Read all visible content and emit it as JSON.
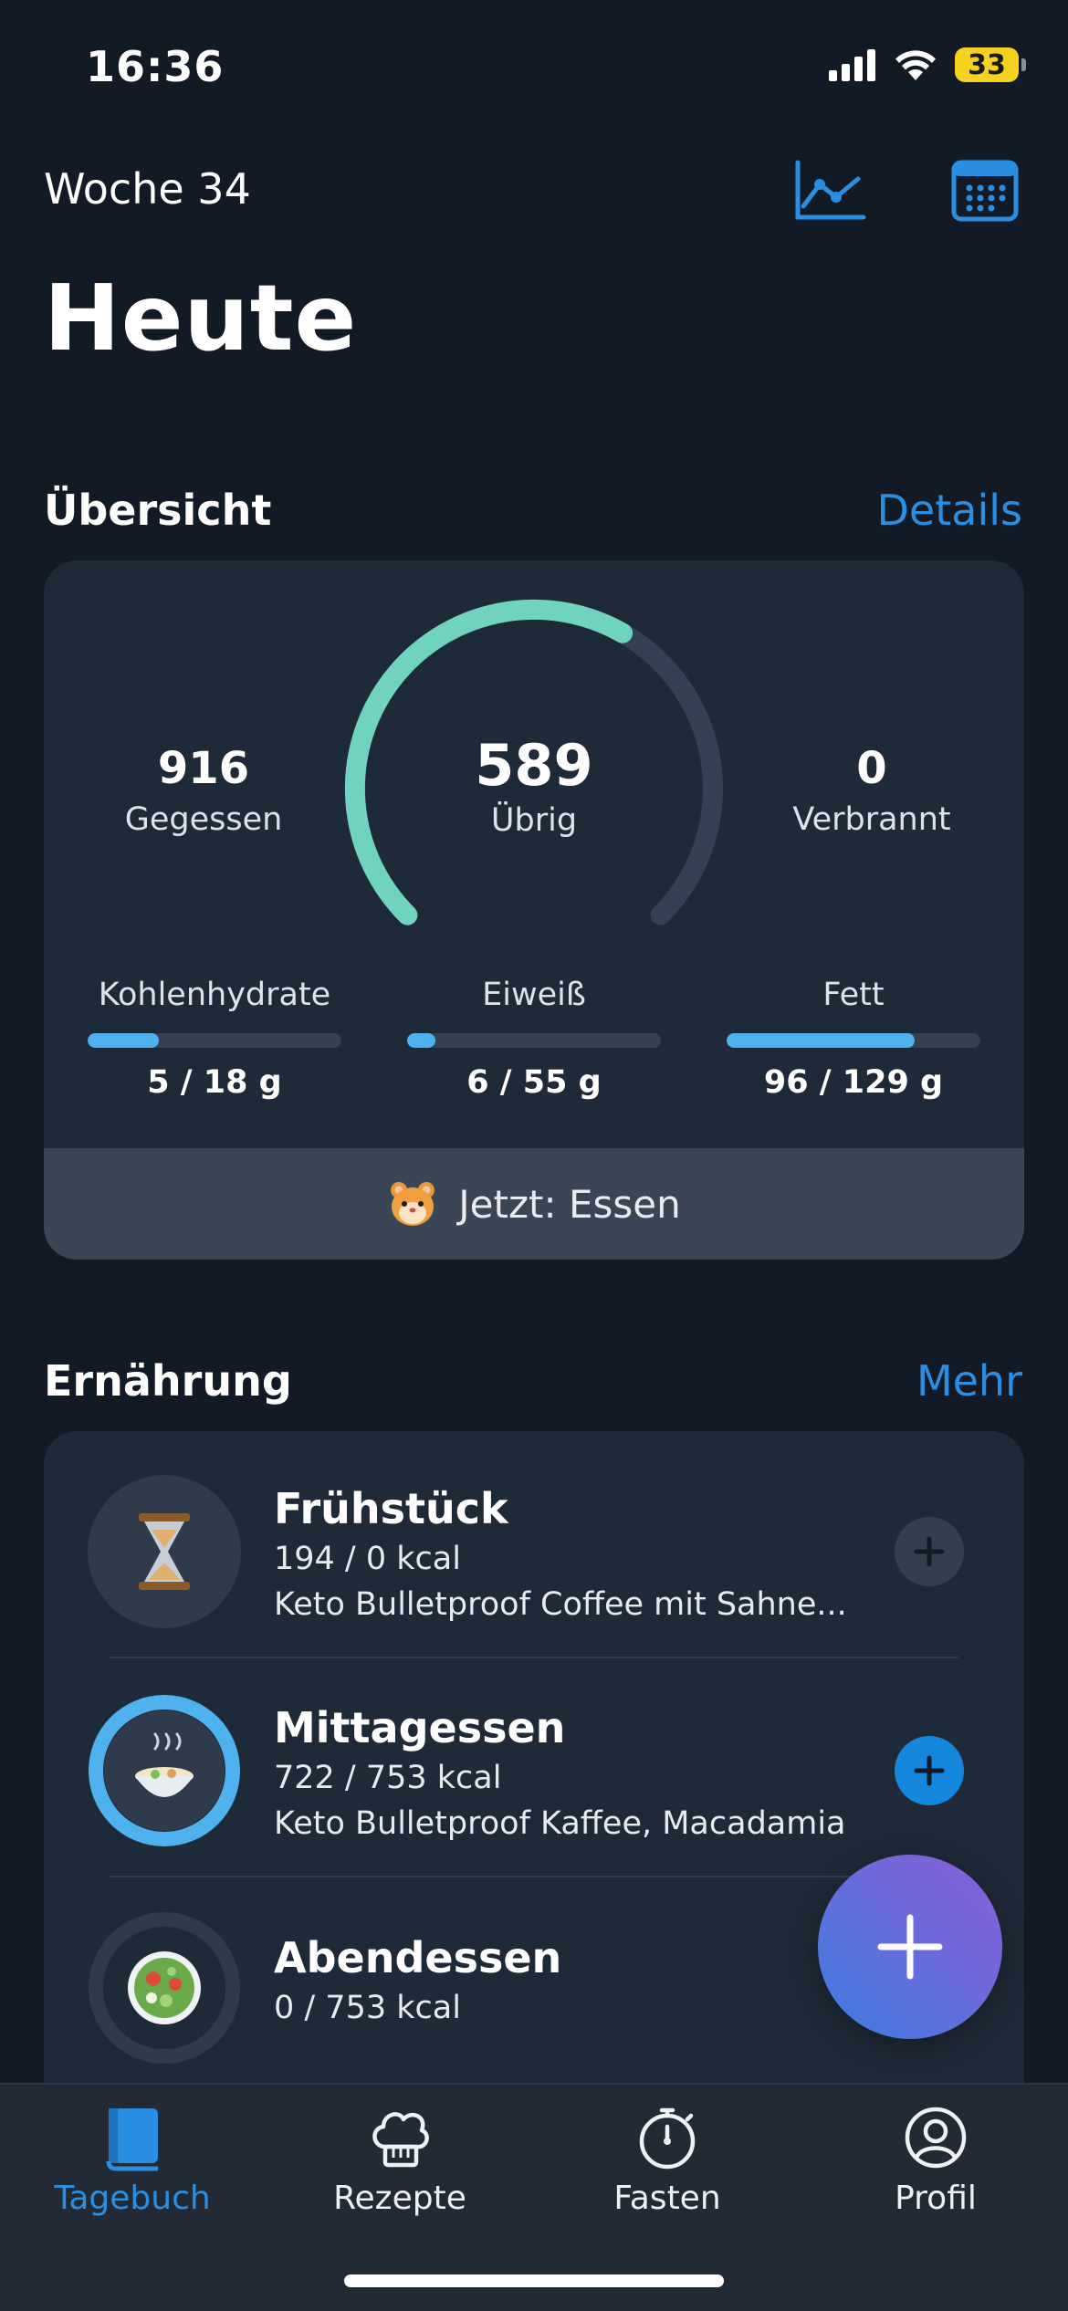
{
  "status": {
    "time": "16:36",
    "battery": "33"
  },
  "header": {
    "week": "Woche 34",
    "title": "Heute"
  },
  "overview": {
    "section_title": "Übersicht",
    "details_link": "Details",
    "eaten": {
      "value": "916",
      "label": "Gegessen"
    },
    "remaining": {
      "value": "589",
      "label": "Übrig"
    },
    "burned": {
      "value": "0",
      "label": "Verbrannt"
    },
    "ring_progress": 0.61,
    "macros": [
      {
        "label": "Kohlenhydrate",
        "value": "5 / 18 g",
        "progress": 0.28
      },
      {
        "label": "Eiweiß",
        "value": "6 / 55 g",
        "progress": 0.11
      },
      {
        "label": "Fett",
        "value": "96 / 129 g",
        "progress": 0.74
      }
    ],
    "now_status": "Jetzt: Essen"
  },
  "nutrition": {
    "section_title": "Ernährung",
    "more_link": "Mehr",
    "meals": [
      {
        "name": "Frühstück",
        "kcal": "194 / 0 kcal",
        "desc": "Keto Bulletproof Coffee mit Sahne...",
        "icon": "hourglass-icon",
        "progress": 0
      },
      {
        "name": "Mittagessen",
        "kcal": "722 / 753 kcal",
        "desc": "Keto Bulletproof Kaffee, Macadamia",
        "icon": "soup-bowl-icon",
        "progress": 0.96
      },
      {
        "name": "Abendessen",
        "kcal": "0 / 753 kcal",
        "desc": "",
        "icon": "salad-bowl-icon",
        "progress": 0
      }
    ]
  },
  "tabs": [
    {
      "label": "Tagebuch",
      "active": true
    },
    {
      "label": "Rezepte",
      "active": false
    },
    {
      "label": "Fasten",
      "active": false
    },
    {
      "label": "Profil",
      "active": false
    }
  ],
  "colors": {
    "background": "#121a26",
    "card": "#1f2a38",
    "accent": "#2a8fe2",
    "ring": "#6fd3c0",
    "bar": "#4fb1ee"
  }
}
